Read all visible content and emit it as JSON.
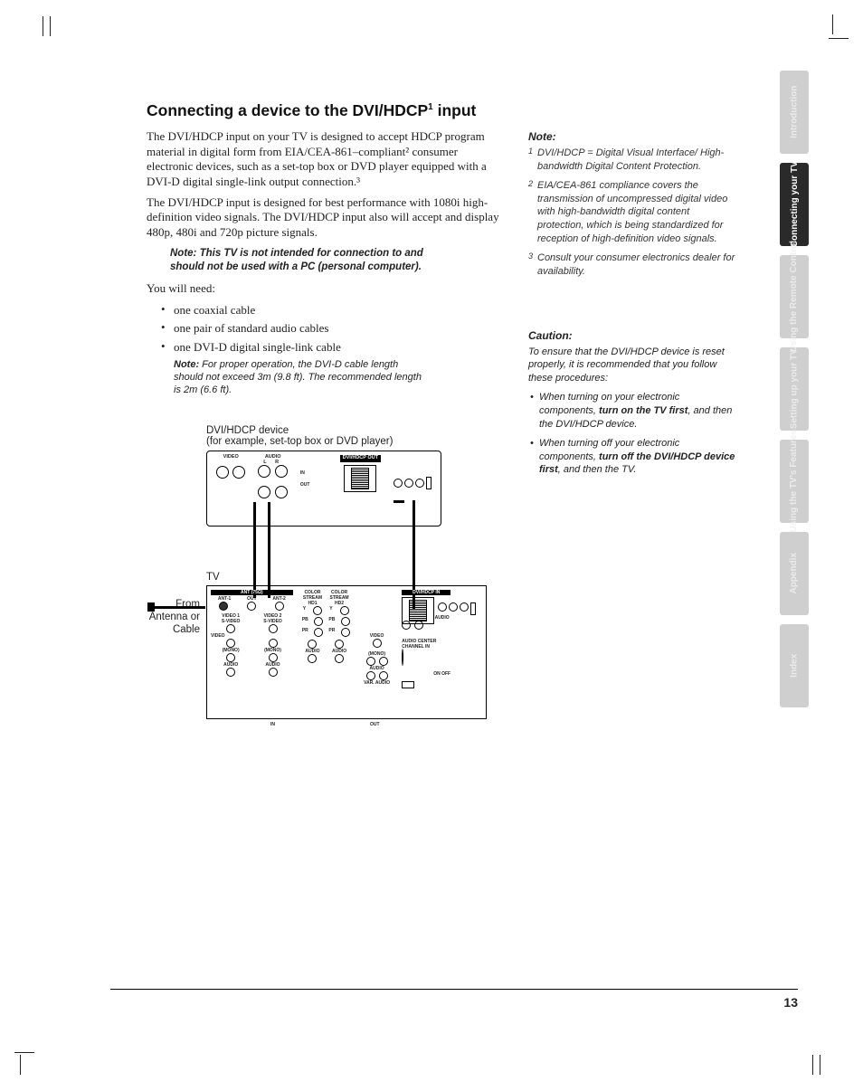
{
  "heading": "Connecting a device to the DVI/HDCP",
  "heading_sup": "1",
  "heading_tail": " input",
  "para1": "The DVI/HDCP input on your TV is designed to accept HDCP program material in digital form from EIA/CEA-861–compliant² consumer electronic devices, such as a set-top box or DVD player equipped with a DVI-D digital single-link output connection.³",
  "para2": "The DVI/HDCP input is designed for best performance with 1080i high-definition video signals. The DVI/HDCP input also will accept and display 480p, 480i and 720p picture signals.",
  "note_bold": "Note: This TV is not intended for connection to and should not be used with a PC (personal computer).",
  "youwillneed": "You will need:",
  "bullets": [
    "one coaxial cable",
    "one pair of standard audio cables",
    "one DVI-D digital single-link cable"
  ],
  "sub_note_label": "Note:",
  "sub_note_text": " For proper operation, the DVI-D cable length should not exceed 3m (9.8 ft). The recommended length is 2m (6.6 ft).",
  "diagram": {
    "device_title": "DVI/HDCP device",
    "device_sub": "(for example, set-top box or DVD player)",
    "tv_label": "TV",
    "from_label": "From Antenna or Cable",
    "lbl_video": "VIDEO",
    "lbl_audio": "AUDIO",
    "lbl_lr": "L    R",
    "lbl_in": "IN",
    "lbl_out": "OUT",
    "lbl_dvi_out": "DVI/HDCP OUT",
    "lbl_dvi_in": "DVI/HDCP IN",
    "lbl_ant": "ANT (75Ω)",
    "lbl_ant1": "ANT-1",
    "lbl_ant2": "ANT-2",
    "lbl_v1": "VIDEO 1",
    "lbl_v2": "VIDEO 2",
    "lbl_svideo": "S-VIDEO",
    "lbl_cs1": "COLOR STREAM HD1",
    "lbl_cs2": "COLOR STREAM HD2",
    "lbl_y": "Y",
    "lbl_pb": "PB",
    "lbl_pr": "PR",
    "lbl_mono": "(MONO)",
    "lbl_audio_s": "AUDIO",
    "lbl_var": "VAR. AUDIO",
    "lbl_onoff": "ON  OFF",
    "lbl_center": "AUDIO CENTER CHANNEL IN"
  },
  "right": {
    "note_h": "Note:",
    "fn1": "DVI/HDCP = Digital Visual Interface/ High-bandwidth Digital Content Protection.",
    "fn2": "EIA/CEA-861 compliance covers the transmission of uncompressed digital video with high-bandwidth digital content protection, which is being standardized for reception of high-definition video signals.",
    "fn3": "Consult your consumer electronics dealer for availability.",
    "caution_h": "Caution:",
    "caution_text": "To ensure that the DVI/HDCP device is reset properly, it is recommended that you follow these procedures:",
    "c1a": "When turning on your electronic components, ",
    "c1b": "turn on the TV first",
    "c1c": ", and then the DVI/HDCP device.",
    "c2a": "When turning off your electronic components, ",
    "c2b": "turn off the DVI/HDCP device first",
    "c2c": ", and then the TV."
  },
  "tabs": [
    "Introduction",
    "Connecting your TV",
    "Using the Remote Control",
    "Setting up your TV",
    "Using the TV's Features",
    "Appendix",
    "Index"
  ],
  "page_number": "13"
}
